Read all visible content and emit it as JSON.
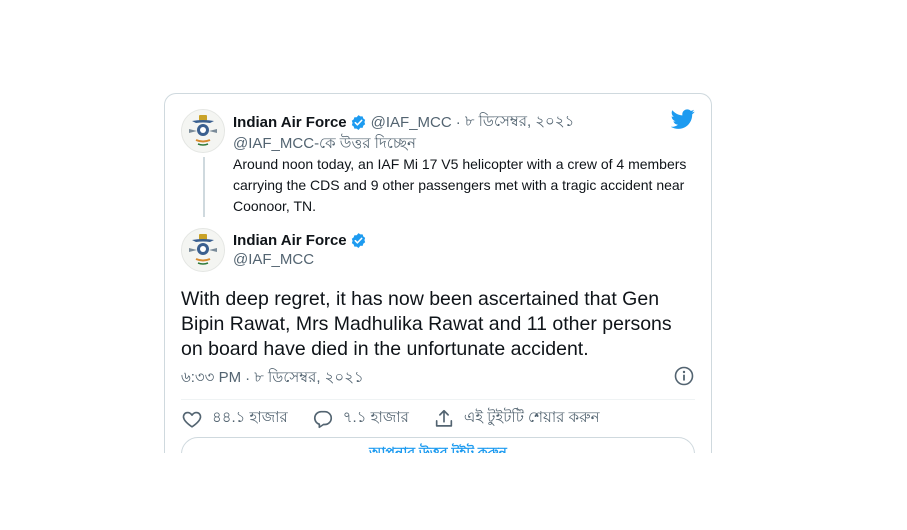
{
  "quoted_tweet": {
    "author_name": "Indian Air Force",
    "handle": "@IAF_MCC",
    "separator": "·",
    "date": "৮ ডিসেম্বর, ২০২১",
    "replying_to": "@IAF_MCC-কে উত্তর দিচ্ছেন",
    "text": "Around noon today, an IAF Mi 17 V5 helicopter with a crew of 4 members carrying the CDS and 9 other passengers met with a tragic accident near Coonoor, TN."
  },
  "main_tweet": {
    "author_name": "Indian Air Force",
    "handle": "@IAF_MCC",
    "text": "With deep regret, it has now been ascertained that Gen Bipin Rawat, Mrs Madhulika Rawat and 11 other persons on board have died in the unfortunate accident.",
    "time": "৬:৩৩ PM",
    "separator": "·",
    "date": "৮ ডিসেম্বর, ২০২১"
  },
  "actions": {
    "likes": "৪৪.১ হাজার",
    "replies": "৭.১ হাজার",
    "share_label": "এই টুইটটি শেয়ার করুন"
  },
  "reply_button_label": "আপনার উত্তর টুইট করুন",
  "colors": {
    "accent": "#1d9bf0",
    "text_primary": "#0f1419",
    "text_secondary": "#536471",
    "border": "#cfd9de"
  },
  "icons": {
    "brand": "twitter-bird-icon",
    "verified": "verified-badge-icon",
    "info": "info-icon",
    "like": "heart-icon",
    "reply": "speech-bubble-icon",
    "share": "share-upload-icon"
  }
}
